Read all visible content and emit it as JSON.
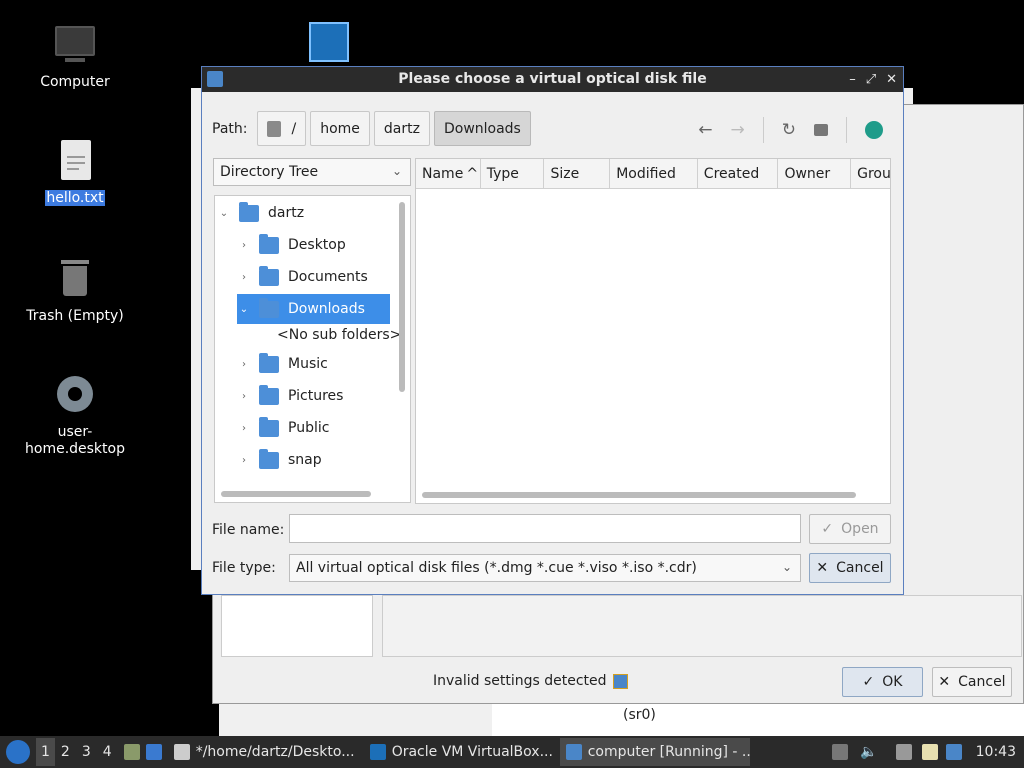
{
  "desktop": {
    "icons": [
      {
        "label": "Computer"
      },
      {
        "label": "hello.txt"
      },
      {
        "label": "Trash (Empty)"
      },
      {
        "label": "user-home.desktop"
      }
    ]
  },
  "background_window": {
    "status_text": "Invalid settings detected",
    "ok_label": "OK",
    "cancel_label": "Cancel",
    "device_text": "(sr0)"
  },
  "dialog": {
    "title": "Please choose a virtual optical disk file",
    "path_label": "Path:",
    "crumbs": [
      "/",
      "home",
      "dartz",
      "Downloads"
    ],
    "view_combo": "Directory Tree",
    "tree": [
      {
        "label": "dartz"
      },
      {
        "label": "Desktop"
      },
      {
        "label": "Documents"
      },
      {
        "label": "Downloads"
      },
      {
        "label": "<No sub folders>"
      },
      {
        "label": "Music"
      },
      {
        "label": "Pictures"
      },
      {
        "label": "Public"
      },
      {
        "label": "snap"
      }
    ],
    "columns": [
      "Name",
      "Type",
      "Size",
      "Modified",
      "Created",
      "Owner",
      "Grou"
    ],
    "file_name_label": "File name:",
    "file_name_value": "",
    "file_type_label": "File type:",
    "file_type_value": "All virtual optical disk files (*.dmg *.cue *.viso *.iso *.cdr)",
    "open_label": "Open",
    "cancel_label": "Cancel"
  },
  "taskbar": {
    "workspaces": [
      "1",
      "2",
      "3",
      "4"
    ],
    "tasks": [
      {
        "label": "*/home/dartz/Deskto..."
      },
      {
        "label": "Oracle VM VirtualBox..."
      },
      {
        "label": "computer [Running] - ..."
      }
    ],
    "clock": "10:43"
  }
}
